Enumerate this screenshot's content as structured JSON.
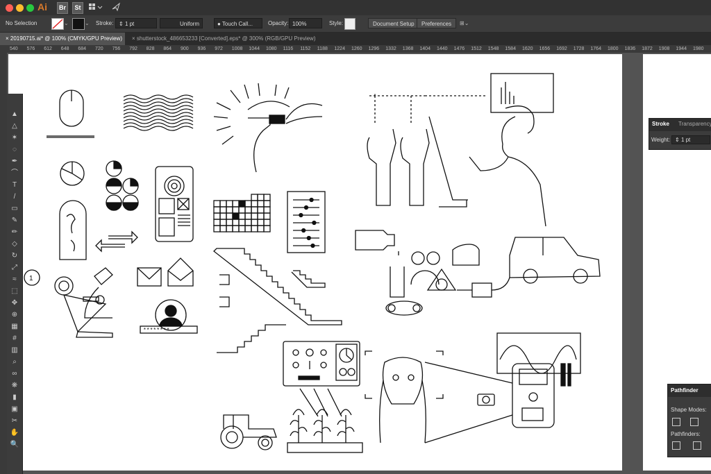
{
  "titlebar": {
    "app_icon": "Ai",
    "bridge_button": "Br",
    "stock_button": "St",
    "workspace_icon": "grid-icon",
    "share_icon": "share-icon"
  },
  "control_bar": {
    "selection": "No Selection",
    "stroke_label": "Stroke:",
    "stroke_value": "1 pt",
    "stroke_style": "Uniform",
    "brush": "Touch Call...",
    "opacity_label": "Opacity:",
    "opacity_value": "100%",
    "style_label": "Style:",
    "document_setup_button": "Document Setup",
    "preferences_button": "Preferences"
  },
  "tabs": [
    {
      "label": "20190715.ai* @ 100% (CMYK/GPU Preview)",
      "close": "×",
      "active": true
    },
    {
      "label": "shutterstock_486653233 [Converted].eps* @ 300% (RGB/GPU Preview)",
      "close": "×",
      "active": false
    }
  ],
  "ruler": {
    "marks": [
      "540",
      "576",
      "612",
      "648",
      "684",
      "720",
      "756",
      "792",
      "828",
      "864",
      "900",
      "936",
      "972",
      "1008",
      "1044",
      "1080",
      "1116",
      "1152",
      "1188",
      "1224",
      "1260",
      "1296",
      "1332",
      "1368",
      "1404",
      "1440",
      "1476",
      "1512",
      "1548",
      "1584",
      "1620",
      "1656",
      "1692",
      "1728",
      "1764",
      "1800",
      "1836",
      "1872",
      "1908",
      "1944",
      "1980"
    ]
  },
  "artboard": {
    "password_field": "********",
    "step_number": "1"
  },
  "stroke_panel": {
    "tabs": [
      "Stroke",
      "Transparency"
    ],
    "weight_label": "Weight:",
    "weight_value": "1 pt"
  },
  "pathfinder_panel": {
    "title": "Pathfinder",
    "shape_modes_label": "Shape Modes:",
    "pathfinders_label": "Pathfinders:"
  },
  "tools": [
    "selection-tool",
    "direct-selection-tool",
    "magic-wand-tool",
    "lasso-tool",
    "pen-tool",
    "curvature-tool",
    "type-tool",
    "line-tool",
    "rectangle-tool",
    "paintbrush-tool",
    "pencil-tool",
    "eraser-tool",
    "rotate-tool",
    "scale-tool",
    "warp-tool",
    "free-transform-tool",
    "puppet-warp-tool",
    "shape-builder-tool",
    "perspective-grid-tool",
    "mesh-tool",
    "gradient-tool",
    "eyedropper-tool",
    "blend-tool",
    "symbol-sprayer-tool",
    "column-graph-tool",
    "artboard-tool",
    "slice-tool",
    "hand-tool",
    "zoom-tool"
  ],
  "colors": {
    "accent": "#d8792b",
    "close": "#fe5f57",
    "minimize": "#febc2e",
    "maximize": "#28c840",
    "panel_bg": "#3c3c3c",
    "canvas_bg": "#535353",
    "line": "#111111"
  }
}
